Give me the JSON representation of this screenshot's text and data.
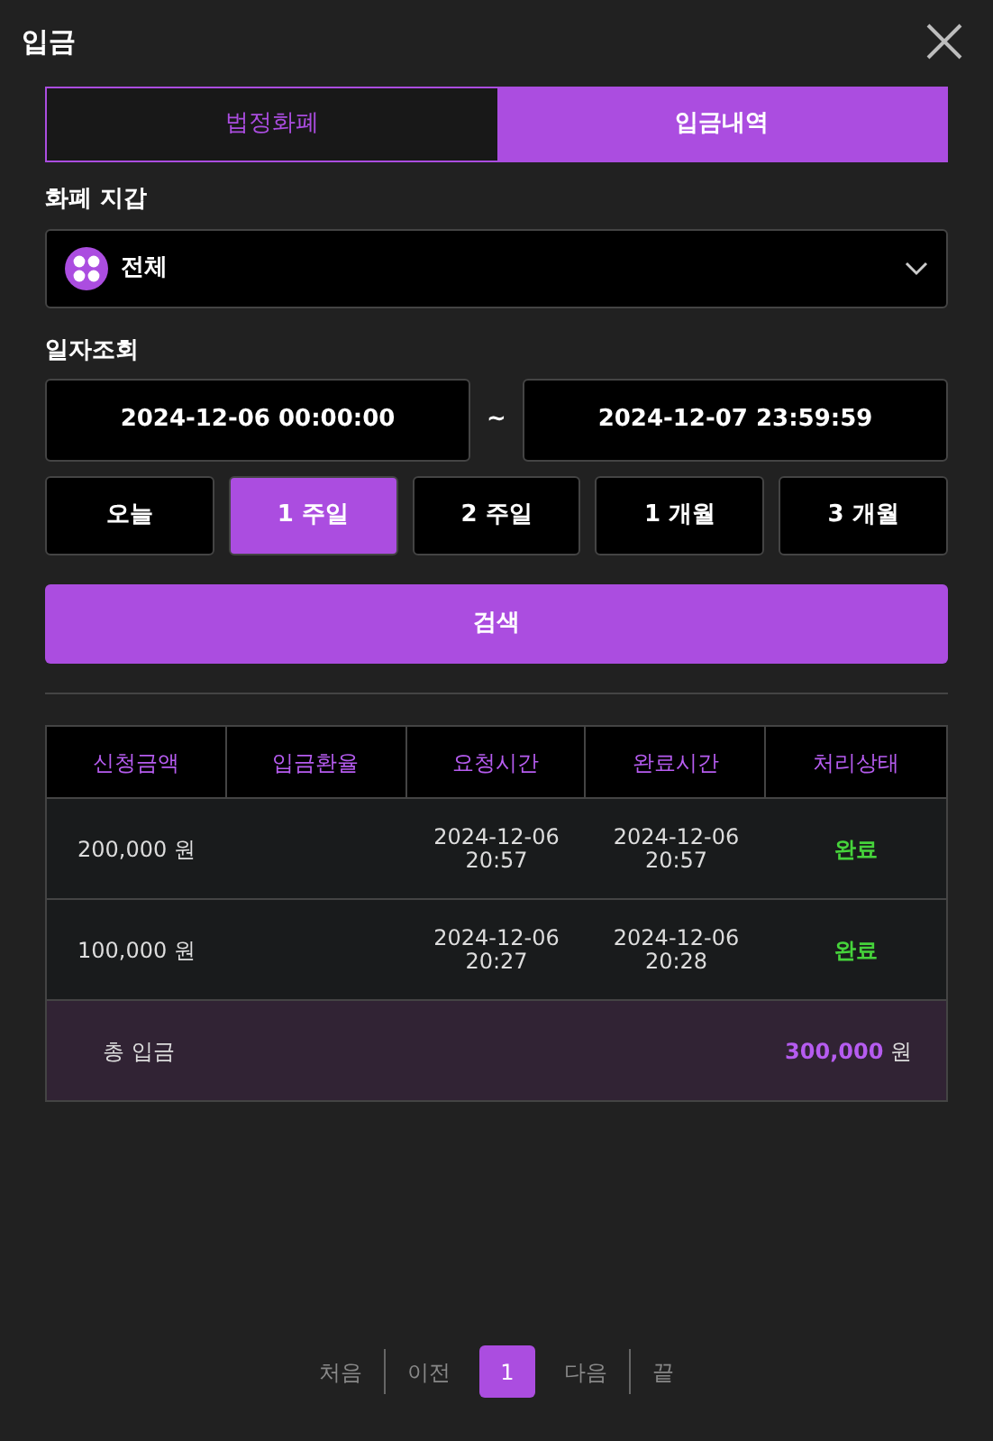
{
  "window": {
    "title": "입금"
  },
  "tabs": [
    {
      "label": "법정화폐",
      "selected": false
    },
    {
      "label": "입금내역",
      "selected": true
    }
  ],
  "wallet": {
    "label": "화폐 지갑",
    "value": "전체"
  },
  "date_range": {
    "label": "일자조회",
    "from": "2024-12-06 00:00:00",
    "separator": "~",
    "to": "2024-12-07 23:59:59"
  },
  "periods": [
    {
      "label": "오늘",
      "selected": false
    },
    {
      "label": "1 주일",
      "selected": true
    },
    {
      "label": "2 주일",
      "selected": false
    },
    {
      "label": "1 개월",
      "selected": false
    },
    {
      "label": "3 개월",
      "selected": false
    }
  ],
  "search_button": "검색",
  "table": {
    "columns": [
      "신청금액",
      "입금환율",
      "요청시간",
      "완료시간",
      "처리상태"
    ],
    "rows": [
      {
        "amount": "200,000 원",
        "requested": [
          "2024-12-06",
          "20:57"
        ],
        "completed": [
          "2024-12-06",
          "20:57"
        ],
        "status": "완료"
      },
      {
        "amount": "100,000 원",
        "requested": [
          "2024-12-06",
          "20:27"
        ],
        "completed": [
          "2024-12-06",
          "20:28"
        ],
        "status": "완료"
      }
    ],
    "total": {
      "label": "총 입금",
      "amount": "300,000",
      "unit": "원"
    }
  },
  "pagination": {
    "first": "처음",
    "prev": "이전",
    "pages": [
      {
        "label": "1",
        "selected": true
      }
    ],
    "next": "다음",
    "last": "끝"
  }
}
